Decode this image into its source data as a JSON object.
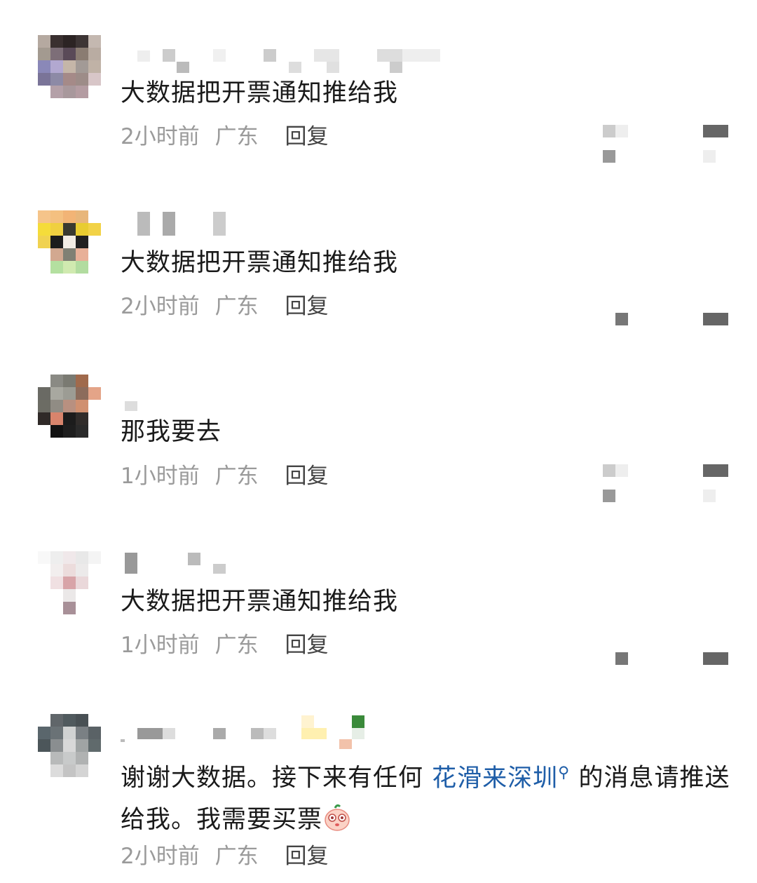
{
  "comments": [
    {
      "text": "大数据把开票通知推给我",
      "time": "2小时前",
      "location": "广东",
      "reply": "回复"
    },
    {
      "text": "大数据把开票通知推给我",
      "time": "2小时前",
      "location": "广东",
      "reply": "回复"
    },
    {
      "text": "那我要去",
      "time": "1小时前",
      "location": "广东",
      "reply": "回复"
    },
    {
      "text": "大数据把开票通知推给我",
      "time": "1小时前",
      "location": "广东",
      "reply": "回复"
    },
    {
      "text_before": "谢谢大数据。接下来有任何",
      "link": "花滑来深圳",
      "text_after": "的消息请推送给我。我需要买票",
      "time": "2小时前",
      "location": "广东",
      "reply": "回复"
    }
  ],
  "icons": {
    "search": "search-icon",
    "emoji": "baby-face-emoji"
  },
  "colors": {
    "text": "#1a1a1a",
    "meta": "#9a9a9a",
    "reply": "#444444",
    "link": "#1f5ea8"
  }
}
